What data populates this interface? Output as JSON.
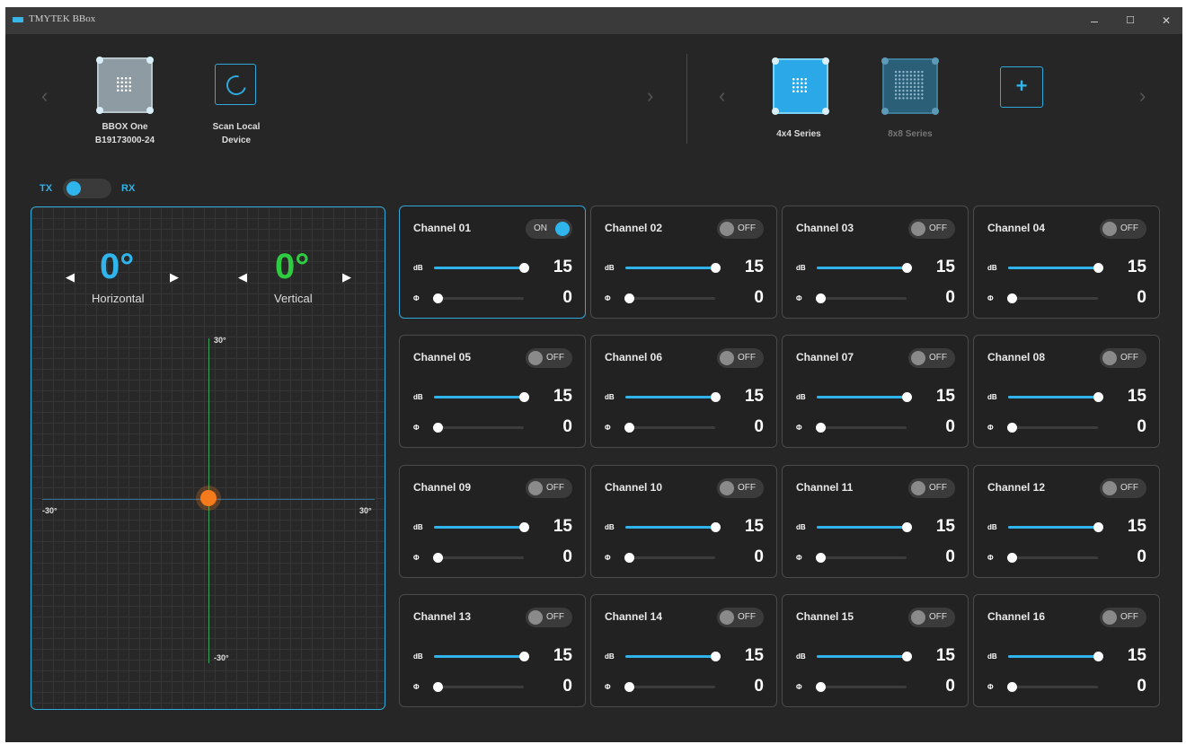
{
  "window": {
    "title": "TMYTEK BBox",
    "minimize": "–",
    "maximize": "☐",
    "close": "✕"
  },
  "devices": {
    "bbox": {
      "name": "BBOX One",
      "serial": "B19173000-24"
    },
    "scan": {
      "line1": "Scan Local",
      "line2": "Device"
    },
    "series_4x4": "4x4 Series",
    "series_8x8": "8x8 Series",
    "add": "+"
  },
  "mode": {
    "tx": "TX",
    "rx": "RX",
    "selected": "TX"
  },
  "beam": {
    "horizontal": {
      "value": "0°",
      "label": "Horizontal"
    },
    "vertical": {
      "value": "0°",
      "label": "Vertical"
    },
    "ticks": {
      "top": "30°",
      "bottom": "-30°",
      "left": "-30°",
      "right": "30°"
    }
  },
  "channels": [
    {
      "name": "Channel 01",
      "state": "ON",
      "db_label": "dB",
      "db": "15",
      "db_level": 1.0,
      "phase_label": "Φ",
      "phase": "0",
      "phase_level": 0.0
    },
    {
      "name": "Channel 02",
      "state": "OFF",
      "db_label": "dB",
      "db": "15",
      "db_level": 1.0,
      "phase_label": "Φ",
      "phase": "0",
      "phase_level": 0.0
    },
    {
      "name": "Channel 03",
      "state": "OFF",
      "db_label": "dB",
      "db": "15",
      "db_level": 1.0,
      "phase_label": "Φ",
      "phase": "0",
      "phase_level": 0.0
    },
    {
      "name": "Channel 04",
      "state": "OFF",
      "db_label": "dB",
      "db": "15",
      "db_level": 1.0,
      "phase_label": "Φ",
      "phase": "0",
      "phase_level": 0.0
    },
    {
      "name": "Channel 05",
      "state": "OFF",
      "db_label": "dB",
      "db": "15",
      "db_level": 1.0,
      "phase_label": "Φ",
      "phase": "0",
      "phase_level": 0.0
    },
    {
      "name": "Channel 06",
      "state": "OFF",
      "db_label": "dB",
      "db": "15",
      "db_level": 1.0,
      "phase_label": "Φ",
      "phase": "0",
      "phase_level": 0.0
    },
    {
      "name": "Channel 07",
      "state": "OFF",
      "db_label": "dB",
      "db": "15",
      "db_level": 1.0,
      "phase_label": "Φ",
      "phase": "0",
      "phase_level": 0.0
    },
    {
      "name": "Channel 08",
      "state": "OFF",
      "db_label": "dB",
      "db": "15",
      "db_level": 1.0,
      "phase_label": "Φ",
      "phase": "0",
      "phase_level": 0.0
    },
    {
      "name": "Channel 09",
      "state": "OFF",
      "db_label": "dB",
      "db": "15",
      "db_level": 1.0,
      "phase_label": "Φ",
      "phase": "0",
      "phase_level": 0.0
    },
    {
      "name": "Channel 10",
      "state": "OFF",
      "db_label": "dB",
      "db": "15",
      "db_level": 1.0,
      "phase_label": "Φ",
      "phase": "0",
      "phase_level": 0.0
    },
    {
      "name": "Channel 11",
      "state": "OFF",
      "db_label": "dB",
      "db": "15",
      "db_level": 1.0,
      "phase_label": "Φ",
      "phase": "0",
      "phase_level": 0.0
    },
    {
      "name": "Channel 12",
      "state": "OFF",
      "db_label": "dB",
      "db": "15",
      "db_level": 1.0,
      "phase_label": "Φ",
      "phase": "0",
      "phase_level": 0.0
    },
    {
      "name": "Channel 13",
      "state": "OFF",
      "db_label": "dB",
      "db": "15",
      "db_level": 1.0,
      "phase_label": "Φ",
      "phase": "0",
      "phase_level": 0.0
    },
    {
      "name": "Channel 14",
      "state": "OFF",
      "db_label": "dB",
      "db": "15",
      "db_level": 1.0,
      "phase_label": "Φ",
      "phase": "0",
      "phase_level": 0.0
    },
    {
      "name": "Channel 15",
      "state": "OFF",
      "db_label": "dB",
      "db": "15",
      "db_level": 1.0,
      "phase_label": "Φ",
      "phase": "0",
      "phase_level": 0.0
    },
    {
      "name": "Channel 16",
      "state": "OFF",
      "db_label": "dB",
      "db": "15",
      "db_level": 1.0,
      "phase_label": "Φ",
      "phase": "0",
      "phase_level": 0.0
    }
  ],
  "colors": {
    "accent": "#2fb4ec",
    "horizontal_value": "#2fb4ec",
    "vertical_value": "#2ecc40",
    "beam_point": "#f57a1c",
    "off_knob": "#8a8a8a"
  }
}
